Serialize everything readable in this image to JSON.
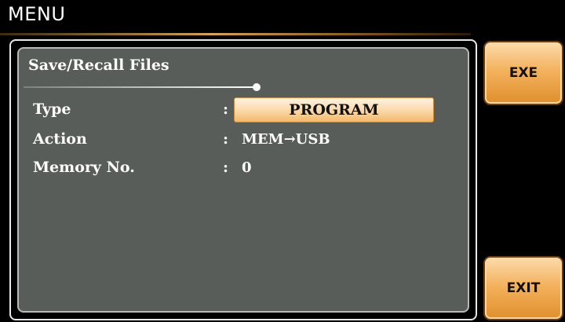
{
  "header": {
    "title": "MENU"
  },
  "panel": {
    "heading": "Save/Recall Files",
    "rows": [
      {
        "label": "Type",
        "separator": ":",
        "value": "PROGRAM",
        "editable": true
      },
      {
        "label": "Action",
        "separator": ":",
        "value": "MEM→USB",
        "editable": false
      },
      {
        "label": "Memory No.",
        "separator": ":",
        "value": "0",
        "editable": false
      }
    ]
  },
  "softkeys": {
    "exe_label": "EXE",
    "exit_label": "EXIT"
  },
  "colors": {
    "screen_background": "#000000",
    "panel_background": "#595d59",
    "softkey_accent": "#f4b25e",
    "selected_field": "#fbd7a6",
    "text": "#ffffff"
  }
}
